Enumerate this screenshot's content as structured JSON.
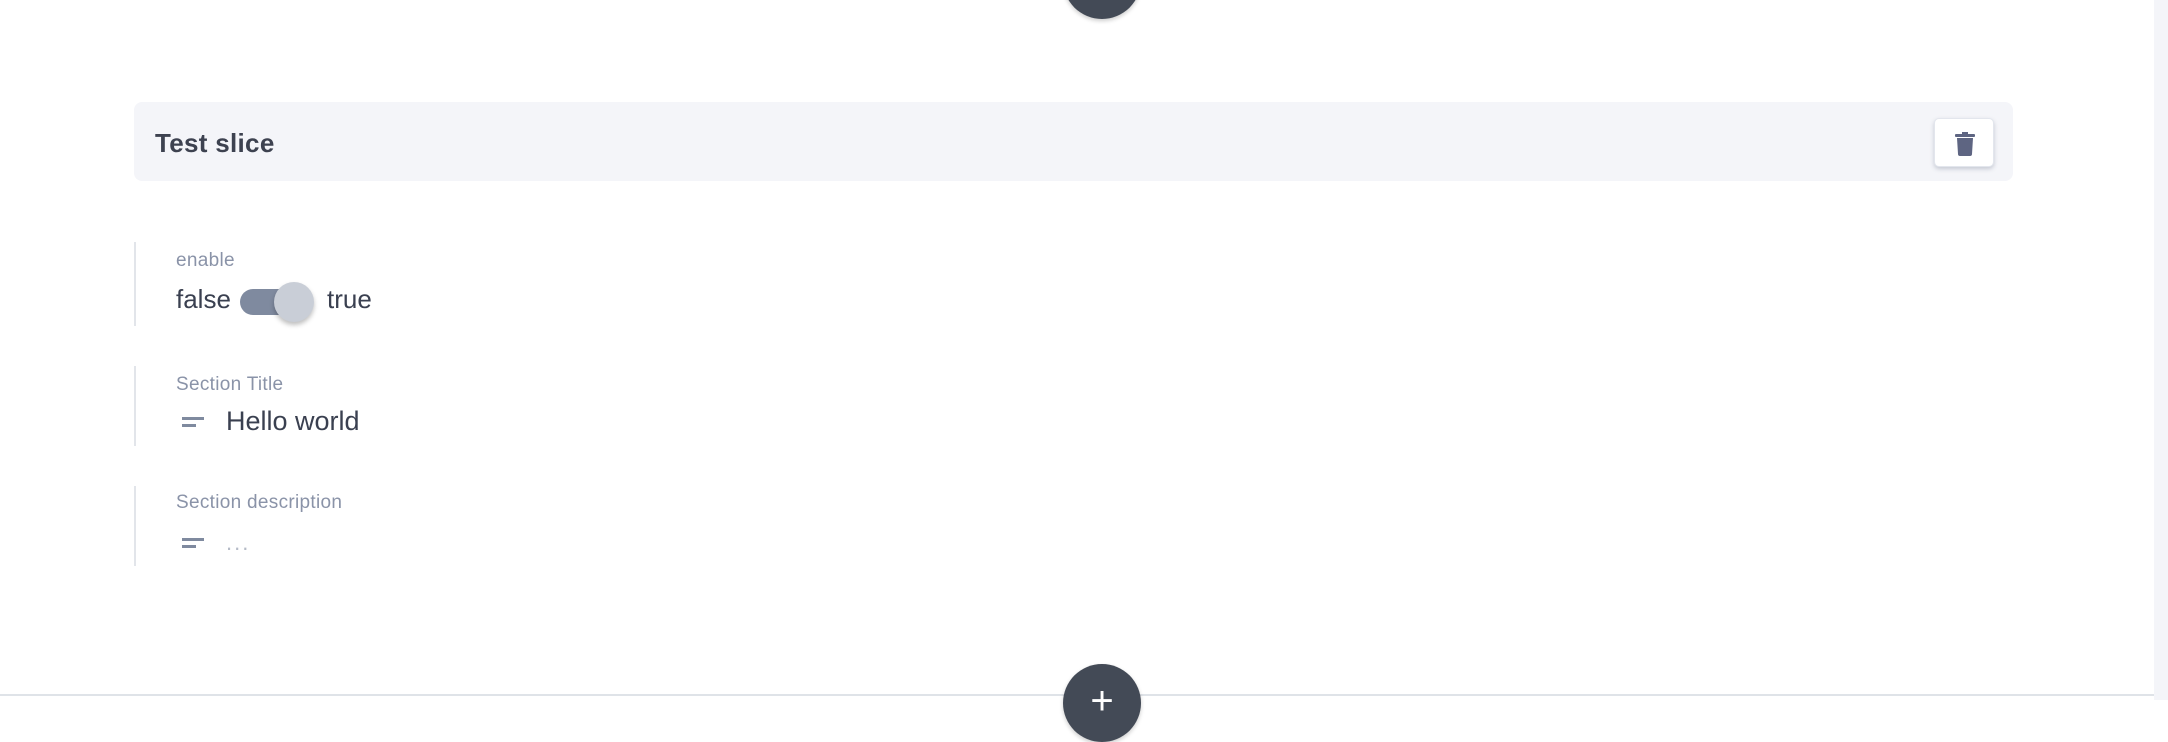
{
  "slice": {
    "title": "Test slice",
    "delete_icon": "trash-icon"
  },
  "fields": [
    {
      "label": "enable",
      "false_label": "false",
      "true_label": "true",
      "value": true
    },
    {
      "label": "Section Title",
      "value": "Hello world"
    },
    {
      "label": "Section description",
      "placeholder": "..."
    }
  ],
  "add_icon": "plus"
}
